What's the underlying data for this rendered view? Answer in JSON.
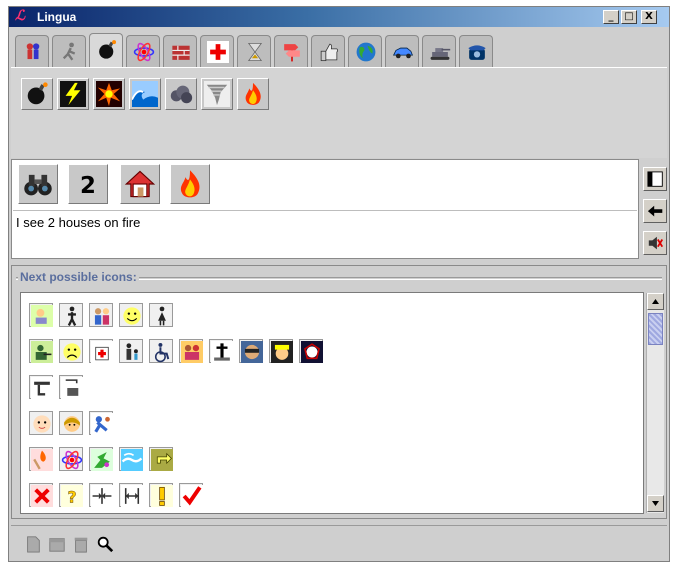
{
  "window": {
    "title": "Lingua",
    "logo": "lingua-logo"
  },
  "window_controls": {
    "minimize": "_",
    "maximize": "□",
    "close": "X"
  },
  "category_tabs": [
    {
      "name": "people-tab",
      "icon": "people-icon",
      "active": false
    },
    {
      "name": "actions-tab",
      "icon": "running-icon",
      "active": false
    },
    {
      "name": "disasters-tab",
      "icon": "bomb-icon",
      "active": true
    },
    {
      "name": "science-tab",
      "icon": "atom-icon",
      "active": false
    },
    {
      "name": "buildings-tab",
      "icon": "wall-icon",
      "active": false
    },
    {
      "name": "medical-tab",
      "icon": "red-cross-icon",
      "active": false
    },
    {
      "name": "time-tab",
      "icon": "hourglass-icon",
      "active": false
    },
    {
      "name": "signs-tab",
      "icon": "signpost-icon",
      "active": false
    },
    {
      "name": "opinion-tab",
      "icon": "thumbs-up-icon",
      "active": false
    },
    {
      "name": "world-tab",
      "icon": "globe-icon",
      "active": false
    },
    {
      "name": "vehicles-tab",
      "icon": "car-icon",
      "active": false
    },
    {
      "name": "military-tab",
      "icon": "tank-icon",
      "active": false
    },
    {
      "name": "phone-tab",
      "icon": "telephone-icon",
      "active": false
    }
  ],
  "category_icons": [
    {
      "name": "bomb-icon"
    },
    {
      "name": "lightning-icon"
    },
    {
      "name": "explosion-icon"
    },
    {
      "name": "wave-icon"
    },
    {
      "name": "smoke-icon"
    },
    {
      "name": "tornado-icon"
    },
    {
      "name": "fire-icon"
    }
  ],
  "sentence_icons": [
    {
      "name": "binoculars-icon"
    },
    {
      "name": "number-two-icon",
      "label": "2"
    },
    {
      "name": "house-icon"
    },
    {
      "name": "fire-icon"
    }
  ],
  "sentence_text": "I see 2 houses on fire",
  "side_buttons": [
    {
      "name": "clear-window-icon"
    },
    {
      "name": "backspace-arrow-icon"
    },
    {
      "name": "speak-muted-icon"
    }
  ],
  "next_icons_label": "Next possible icons:",
  "next_icon_rows": [
    [
      "sick-man-icon",
      "man-icon",
      "family-icon",
      "smiley-icon",
      "woman-icon"
    ],
    [
      "soldier-icon",
      "sad-face-icon",
      "nurse-icon",
      "mother-child-icon",
      "wheelchair-icon",
      "couple-icon",
      "grave-icon",
      "robber-icon",
      "police-icon",
      "vampire-icon"
    ],
    [
      "toilet-man-icon",
      "shower-icon"
    ],
    [
      "baby-icon",
      "girl-icon",
      "thief-icon"
    ],
    [
      "match-icon",
      "atom-icon",
      "broken-icon",
      "sky-icon",
      "pointing-icon"
    ],
    [
      "cross-mark-icon",
      "question-mark-icon",
      "narrow-icon",
      "wide-icon",
      "exclamation-icon",
      "check-mark-icon"
    ]
  ],
  "bottom_tools": [
    {
      "name": "new-document-icon"
    },
    {
      "name": "folder-icon"
    },
    {
      "name": "trash-icon"
    },
    {
      "name": "search-icon"
    }
  ]
}
